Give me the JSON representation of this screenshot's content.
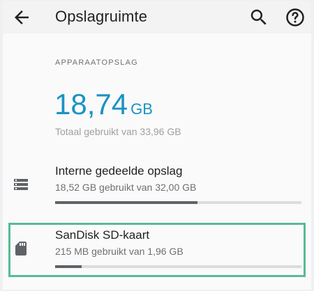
{
  "header": {
    "title": "Opslagruimte",
    "back_icon": "arrow-back-icon",
    "search_icon": "search-icon",
    "help_icon": "help-icon"
  },
  "summary": {
    "section_label": "APPARAATOPSLAG",
    "used_value": "18,74",
    "used_unit": "GB",
    "total_text": "Totaal gebruikt van 33,96 GB"
  },
  "storage_items": [
    {
      "icon": "storage-list-icon",
      "title": "Interne gedeelde opslag",
      "subtitle": "18,52 GB gebruikt van 32,00 GB",
      "usage_fraction": 0.579
    },
    {
      "icon": "sd-card-icon",
      "title": "SanDisk SD-kaart",
      "subtitle": "215 MB gebruikt van 1,96 GB",
      "usage_fraction": 0.107
    }
  ],
  "colors": {
    "accent": "#1a93c2",
    "highlight": "#56bb96",
    "progress": "#5f6368"
  }
}
